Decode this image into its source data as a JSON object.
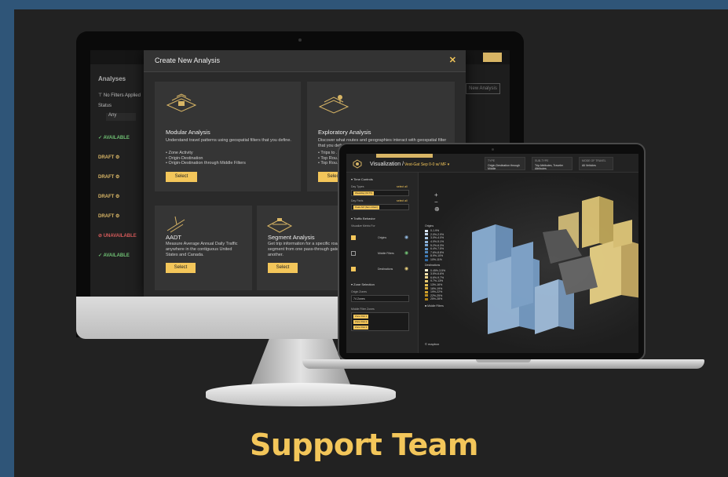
{
  "headline": "Support Team",
  "colors": {
    "gold": "#f3c65a",
    "frame": "#2f5578",
    "panel": "#222222",
    "blue_series": "#8fb5dc",
    "yellow_series": "#e6cc7a"
  },
  "desktop": {
    "sidebar_title": "Analyses",
    "filter_text": "No Filters Applied",
    "status_label": "Status",
    "status_value": "Any",
    "right_button": "New Analysis",
    "rows": [
      {
        "label": "✓ AVAILABLE",
        "color": "#6fbf73"
      },
      {
        "label": "DRAFT ⚙",
        "color": "#d8b565"
      },
      {
        "label": "DRAFT ⚙",
        "color": "#d8b565"
      },
      {
        "label": "DRAFT ⚙",
        "color": "#d8b565"
      },
      {
        "label": "DRAFT ⚙",
        "color": "#d8b565"
      },
      {
        "label": "⊘ UNAVAILABLE",
        "color": "#d65b5b"
      },
      {
        "label": "✓ AVAILABLE",
        "color": "#6fbf73"
      }
    ],
    "modal": {
      "title": "Create New Analysis",
      "close_icon": "close-icon",
      "cards": [
        {
          "title": "Modular Analysis",
          "desc": "Understand travel patterns using geospatial filters that you define.",
          "bullets": [
            "• Zone Activity",
            "• Origin-Destination",
            "• Origin-Destination through Middle Filters"
          ],
          "button": "Select"
        },
        {
          "title": "Exploratory Analysis",
          "desc": "Discover what routes and geographies interact with geospatial filter that you define.",
          "bullets": [
            "• Trips to ...",
            "• Top Rou...",
            "• Top Rou..."
          ],
          "button": "Selec"
        },
        {
          "title": "AADT",
          "desc": "Measure Average Annual Daily Traffic anywhere in the contiguous United States and Canada.",
          "bullets": [],
          "button": "Select"
        },
        {
          "title": "Segment Analysis",
          "desc": "Get trip information for a specific road segment from one pass-through gate to another.",
          "bullets": [],
          "button": "Select"
        }
      ]
    }
  },
  "laptop": {
    "title": "Visualization /",
    "subtitle": "Vest-Gat Sep 0-0 w/ MF ▾",
    "meta": [
      {
        "head": "TYPE",
        "value": "Origin-Destination through Middle"
      },
      {
        "head": "SUB-TYPE",
        "value": "Trip Attributes, Traveler Attributes"
      },
      {
        "head": "MODE OF TRAVEL",
        "value": "All Vehicles"
      }
    ],
    "panel": {
      "time_controls": "▾ Time Controls",
      "day_types": "Day Types",
      "day_types_value": "Weekday (M-Th)",
      "day_parts": "Day Parts",
      "day_parts_value": "Peak AM (6am-10am)",
      "select_all": "select all",
      "traffic_behavior": "▾ Traffic Behavior",
      "metric_for": "Visualize Metric For",
      "layers": [
        {
          "label": "Origins",
          "checked": true
        },
        {
          "label": "Middle Filters",
          "checked": false
        },
        {
          "label": "Destinations",
          "checked": true
        }
      ],
      "zone_selection": "▾ Zone Selection",
      "origin_zones": "Origin Zones",
      "zones_value": "74 Zones",
      "middle_zones": "Middle Filter Zones",
      "chips": [
        "Zone Dist 1",
        "Zone Dist 2",
        "Zone Dist 3"
      ]
    },
    "legend": {
      "origins_title": "Origins",
      "origins": [
        {
          "label": "0-1.9%",
          "color": "#dde8f4"
        },
        {
          "label": "2.0%-2.9%",
          "color": "#c5d8ec"
        },
        {
          "label": "3.0%-4.0%",
          "color": "#abc8e4"
        },
        {
          "label": "4.0%-5.1%",
          "color": "#90b6dc"
        },
        {
          "label": "5.2%-6.3%",
          "color": "#78a5d2"
        },
        {
          "label": "6.4%-7.5%",
          "color": "#6296c8"
        },
        {
          "label": "7.6%-8.8%",
          "color": "#4f87bd"
        },
        {
          "label": "8.9%-10%",
          "color": "#3c77b0"
        },
        {
          "label": "10%-11%",
          "color": "#2e67a0"
        }
      ],
      "destinations_title": "Destinations",
      "destinations": [
        {
          "label": "0.45%-3.5%",
          "color": "#f6edcf"
        },
        {
          "label": "3.5%-6.6%",
          "color": "#f0e0aa"
        },
        {
          "label": "6.6%-9.7%",
          "color": "#ead38a"
        },
        {
          "label": "9.7%-13%",
          "color": "#e6c86f"
        },
        {
          "label": "13%-16%",
          "color": "#e0bb52"
        },
        {
          "label": "16%-19%",
          "color": "#d9ae3e"
        },
        {
          "label": "19%-22%",
          "color": "#cfa02c"
        },
        {
          "label": "22%-25%",
          "color": "#c1911f"
        },
        {
          "label": "25%-28%",
          "color": "#b08214"
        }
      ],
      "middle": "■ Middle Filters",
      "attribution": "© mapbox"
    },
    "zoom": [
      "+",
      "−",
      "⊕"
    ]
  }
}
